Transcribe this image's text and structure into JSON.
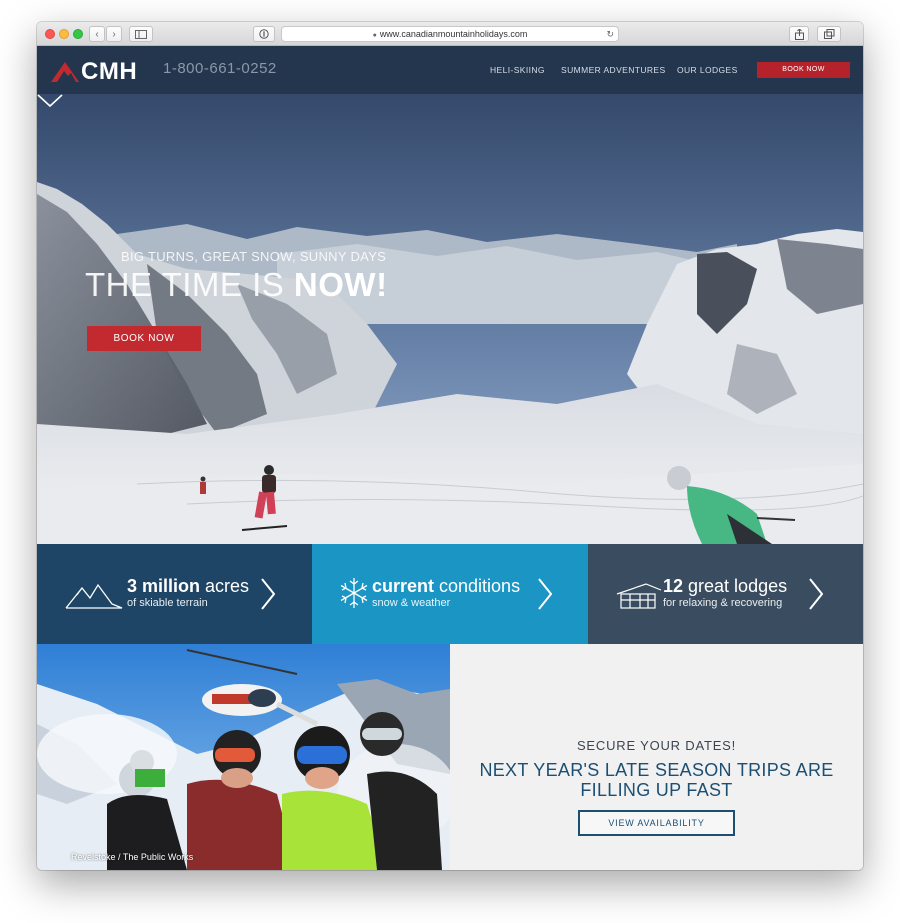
{
  "browser": {
    "url": "www.canadianmountainholidays.com",
    "back_glyph": "‹",
    "forward_glyph": "›",
    "new_tab_glyph": "+"
  },
  "nav": {
    "logo_text": "CMH",
    "phone": "1-800-661-0252",
    "links": [
      "HELI-SKIING",
      "SUMMER ADVENTURES",
      "OUR LODGES"
    ],
    "book_label": "BOOK NOW"
  },
  "hero": {
    "subtitle": "BIG TURNS, GREAT SNOW, SUNNY DAYS",
    "title_light": "THE TIME IS ",
    "title_bold": "NOW!",
    "book_label": "BOOK NOW"
  },
  "tiles": [
    {
      "big_bold": "3 million",
      "big_rest": " acres",
      "small": "of skiable terrain",
      "icon": "mountains-icon"
    },
    {
      "big_bold": "current",
      "big_rest": " conditions",
      "small": "snow & weather",
      "icon": "snowflake-icon"
    },
    {
      "big_bold": "12",
      "big_rest": " great lodges",
      "small": "for relaxing & recovering",
      "icon": "lodge-icon"
    }
  ],
  "promo": {
    "photo_credit": "Revelstoke / The Public Works",
    "kicker": "SECURE YOUR DATES!",
    "headline_1": "NEXT YEAR'S LATE SEASON TRIPS ARE",
    "headline_2": "FILLING UP FAST",
    "button": "VIEW AVAILABILITY"
  },
  "colors": {
    "nav_bg": "#23364d",
    "accent_red": "#c22a30",
    "tile_1": "#1e4565",
    "tile_2": "#1a95c4",
    "tile_3": "#3a4d60",
    "promo_text": "#1d4f73"
  }
}
